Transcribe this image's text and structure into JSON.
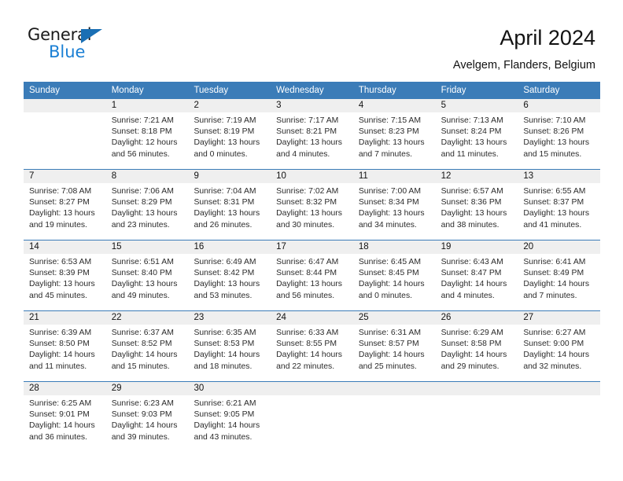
{
  "brand": {
    "name_top": "General",
    "name_bottom": "Blue",
    "triangle_color": "#1a6fb4",
    "blue_text_color": "#1a7fd4"
  },
  "header": {
    "title": "April 2024",
    "subtitle": "Avelgem, Flanders, Belgium"
  },
  "theme": {
    "header_blue": "#3b7cb8",
    "daynum_gray": "#efefef",
    "separator_blue": "#3b7cb8"
  },
  "calendar": {
    "weekday_headers": [
      "Sunday",
      "Monday",
      "Tuesday",
      "Wednesday",
      "Thursday",
      "Friday",
      "Saturday"
    ],
    "weeks": [
      [
        {
          "day": "",
          "lines": []
        },
        {
          "day": "1",
          "lines": [
            "Sunrise: 7:21 AM",
            "Sunset: 8:18 PM",
            "Daylight: 12 hours",
            "and 56 minutes."
          ]
        },
        {
          "day": "2",
          "lines": [
            "Sunrise: 7:19 AM",
            "Sunset: 8:19 PM",
            "Daylight: 13 hours",
            "and 0 minutes."
          ]
        },
        {
          "day": "3",
          "lines": [
            "Sunrise: 7:17 AM",
            "Sunset: 8:21 PM",
            "Daylight: 13 hours",
            "and 4 minutes."
          ]
        },
        {
          "day": "4",
          "lines": [
            "Sunrise: 7:15 AM",
            "Sunset: 8:23 PM",
            "Daylight: 13 hours",
            "and 7 minutes."
          ]
        },
        {
          "day": "5",
          "lines": [
            "Sunrise: 7:13 AM",
            "Sunset: 8:24 PM",
            "Daylight: 13 hours",
            "and 11 minutes."
          ]
        },
        {
          "day": "6",
          "lines": [
            "Sunrise: 7:10 AM",
            "Sunset: 8:26 PM",
            "Daylight: 13 hours",
            "and 15 minutes."
          ]
        }
      ],
      [
        {
          "day": "7",
          "lines": [
            "Sunrise: 7:08 AM",
            "Sunset: 8:27 PM",
            "Daylight: 13 hours",
            "and 19 minutes."
          ]
        },
        {
          "day": "8",
          "lines": [
            "Sunrise: 7:06 AM",
            "Sunset: 8:29 PM",
            "Daylight: 13 hours",
            "and 23 minutes."
          ]
        },
        {
          "day": "9",
          "lines": [
            "Sunrise: 7:04 AM",
            "Sunset: 8:31 PM",
            "Daylight: 13 hours",
            "and 26 minutes."
          ]
        },
        {
          "day": "10",
          "lines": [
            "Sunrise: 7:02 AM",
            "Sunset: 8:32 PM",
            "Daylight: 13 hours",
            "and 30 minutes."
          ]
        },
        {
          "day": "11",
          "lines": [
            "Sunrise: 7:00 AM",
            "Sunset: 8:34 PM",
            "Daylight: 13 hours",
            "and 34 minutes."
          ]
        },
        {
          "day": "12",
          "lines": [
            "Sunrise: 6:57 AM",
            "Sunset: 8:36 PM",
            "Daylight: 13 hours",
            "and 38 minutes."
          ]
        },
        {
          "day": "13",
          "lines": [
            "Sunrise: 6:55 AM",
            "Sunset: 8:37 PM",
            "Daylight: 13 hours",
            "and 41 minutes."
          ]
        }
      ],
      [
        {
          "day": "14",
          "lines": [
            "Sunrise: 6:53 AM",
            "Sunset: 8:39 PM",
            "Daylight: 13 hours",
            "and 45 minutes."
          ]
        },
        {
          "day": "15",
          "lines": [
            "Sunrise: 6:51 AM",
            "Sunset: 8:40 PM",
            "Daylight: 13 hours",
            "and 49 minutes."
          ]
        },
        {
          "day": "16",
          "lines": [
            "Sunrise: 6:49 AM",
            "Sunset: 8:42 PM",
            "Daylight: 13 hours",
            "and 53 minutes."
          ]
        },
        {
          "day": "17",
          "lines": [
            "Sunrise: 6:47 AM",
            "Sunset: 8:44 PM",
            "Daylight: 13 hours",
            "and 56 minutes."
          ]
        },
        {
          "day": "18",
          "lines": [
            "Sunrise: 6:45 AM",
            "Sunset: 8:45 PM",
            "Daylight: 14 hours",
            "and 0 minutes."
          ]
        },
        {
          "day": "19",
          "lines": [
            "Sunrise: 6:43 AM",
            "Sunset: 8:47 PM",
            "Daylight: 14 hours",
            "and 4 minutes."
          ]
        },
        {
          "day": "20",
          "lines": [
            "Sunrise: 6:41 AM",
            "Sunset: 8:49 PM",
            "Daylight: 14 hours",
            "and 7 minutes."
          ]
        }
      ],
      [
        {
          "day": "21",
          "lines": [
            "Sunrise: 6:39 AM",
            "Sunset: 8:50 PM",
            "Daylight: 14 hours",
            "and 11 minutes."
          ]
        },
        {
          "day": "22",
          "lines": [
            "Sunrise: 6:37 AM",
            "Sunset: 8:52 PM",
            "Daylight: 14 hours",
            "and 15 minutes."
          ]
        },
        {
          "day": "23",
          "lines": [
            "Sunrise: 6:35 AM",
            "Sunset: 8:53 PM",
            "Daylight: 14 hours",
            "and 18 minutes."
          ]
        },
        {
          "day": "24",
          "lines": [
            "Sunrise: 6:33 AM",
            "Sunset: 8:55 PM",
            "Daylight: 14 hours",
            "and 22 minutes."
          ]
        },
        {
          "day": "25",
          "lines": [
            "Sunrise: 6:31 AM",
            "Sunset: 8:57 PM",
            "Daylight: 14 hours",
            "and 25 minutes."
          ]
        },
        {
          "day": "26",
          "lines": [
            "Sunrise: 6:29 AM",
            "Sunset: 8:58 PM",
            "Daylight: 14 hours",
            "and 29 minutes."
          ]
        },
        {
          "day": "27",
          "lines": [
            "Sunrise: 6:27 AM",
            "Sunset: 9:00 PM",
            "Daylight: 14 hours",
            "and 32 minutes."
          ]
        }
      ],
      [
        {
          "day": "28",
          "lines": [
            "Sunrise: 6:25 AM",
            "Sunset: 9:01 PM",
            "Daylight: 14 hours",
            "and 36 minutes."
          ]
        },
        {
          "day": "29",
          "lines": [
            "Sunrise: 6:23 AM",
            "Sunset: 9:03 PM",
            "Daylight: 14 hours",
            "and 39 minutes."
          ]
        },
        {
          "day": "30",
          "lines": [
            "Sunrise: 6:21 AM",
            "Sunset: 9:05 PM",
            "Daylight: 14 hours",
            "and 43 minutes."
          ]
        },
        {
          "day": "",
          "lines": []
        },
        {
          "day": "",
          "lines": []
        },
        {
          "day": "",
          "lines": []
        },
        {
          "day": "",
          "lines": []
        }
      ]
    ]
  }
}
